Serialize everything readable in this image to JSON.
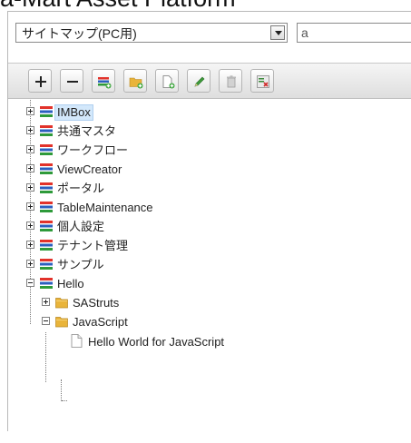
{
  "header": {
    "title": "a-Mart Asset Platform"
  },
  "site_select": {
    "value": "サイトマップ(PC用)",
    "right_field_text": "a"
  },
  "toolbar": {
    "buttons": [
      {
        "name": "expand-all-button",
        "icon": "plus-icon"
      },
      {
        "name": "collapse-all-button",
        "icon": "minus-icon"
      },
      {
        "name": "add-category-button",
        "icon": "add-category-icon"
      },
      {
        "name": "add-folder-button",
        "icon": "add-folder-icon"
      },
      {
        "name": "add-page-button",
        "icon": "add-page-icon"
      },
      {
        "name": "edit-button",
        "icon": "pencil-icon"
      },
      {
        "name": "delete-button",
        "icon": "trash-icon"
      },
      {
        "name": "remove-button",
        "icon": "remove-icon"
      }
    ]
  },
  "tree": {
    "items": [
      {
        "label": "IMBox",
        "type": "category",
        "state": "collapsed",
        "selected": true
      },
      {
        "label": "共通マスタ",
        "type": "category",
        "state": "collapsed"
      },
      {
        "label": "ワークフロー",
        "type": "category",
        "state": "collapsed"
      },
      {
        "label": "ViewCreator",
        "type": "category",
        "state": "collapsed"
      },
      {
        "label": "ポータル",
        "type": "category",
        "state": "collapsed"
      },
      {
        "label": "TableMaintenance",
        "type": "category",
        "state": "collapsed"
      },
      {
        "label": "個人設定",
        "type": "category",
        "state": "collapsed"
      },
      {
        "label": "テナント管理",
        "type": "category",
        "state": "collapsed"
      },
      {
        "label": "サンプル",
        "type": "category",
        "state": "collapsed"
      },
      {
        "label": "Hello",
        "type": "category",
        "state": "expanded"
      },
      {
        "label": "SAStruts",
        "type": "folder",
        "state": "collapsed"
      },
      {
        "label": "JavaScript",
        "type": "folder",
        "state": "expanded"
      },
      {
        "label": "Hello World for JavaScript",
        "type": "page"
      }
    ]
  },
  "colors": {
    "selection": "#d3e8fb",
    "toolbar": "#e6e6e6",
    "category_red": "#e2322a",
    "category_blue": "#2b5fbf",
    "category_green": "#2e9a3a",
    "folder": "#e9b43a"
  }
}
